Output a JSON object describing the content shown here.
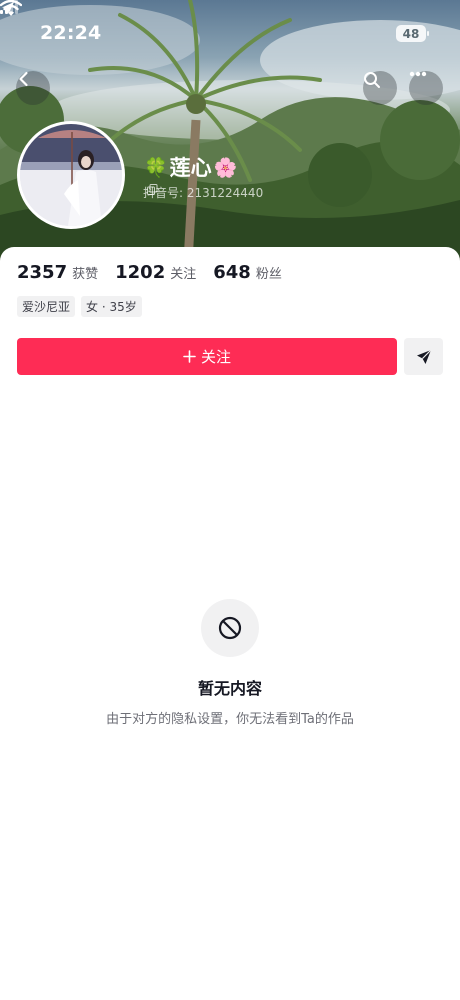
{
  "status_bar": {
    "time": "22:24",
    "battery": "48",
    "icons": [
      "location-arrow-icon",
      "signal-icon",
      "wifi-icon",
      "battery-icon"
    ]
  },
  "header": {
    "icons": [
      "back-icon",
      "search-icon",
      "more-icon"
    ]
  },
  "profile": {
    "name": "莲心",
    "name_prefix_emoji": "🍀",
    "name_suffix_emoji": "🌸",
    "douyin_id": "抖音号: 2131224440",
    "stats": [
      {
        "value": "2357",
        "label": "获赞"
      },
      {
        "value": "1202",
        "label": "关注"
      },
      {
        "value": "648",
        "label": "粉丝"
      }
    ],
    "tags": [
      "爱沙尼亚",
      "女 · 35岁"
    ]
  },
  "actions": {
    "follow_label": "关注",
    "follow_color": "#fe2c55"
  },
  "empty_state": {
    "title": "暂无内容",
    "description": "由于对方的隐私设置，你无法看到Ta的作品",
    "icon": "ban-icon"
  }
}
